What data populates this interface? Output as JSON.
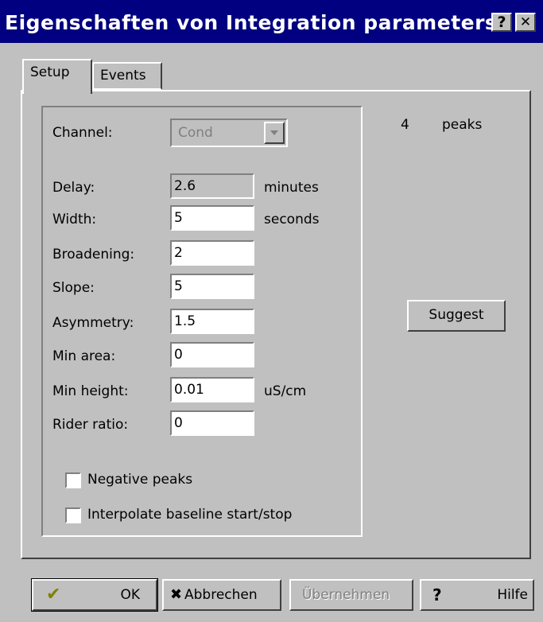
{
  "window": {
    "title": "Eigenschaften von Integration parameters",
    "help_button": "?",
    "close_button": "✕"
  },
  "tabs": [
    {
      "label": "Setup",
      "active": true
    },
    {
      "label": "Events",
      "active": false
    }
  ],
  "channel": {
    "label": "Channel:",
    "value": "Cond"
  },
  "fields": {
    "delay": {
      "label": "Delay:",
      "value": "2.6",
      "unit": "minutes"
    },
    "width": {
      "label": "Width:",
      "value": "5",
      "unit": "seconds"
    },
    "broadening": {
      "label": "Broadening:",
      "value": "2"
    },
    "slope": {
      "label": "Slope:",
      "value": "5"
    },
    "asymmetry": {
      "label": "Asymmetry:",
      "value": "1.5"
    },
    "min_area": {
      "label": "Min area:",
      "value": "0"
    },
    "min_height": {
      "label": "Min height:",
      "value": "0.01",
      "unit": "uS/cm"
    },
    "rider_ratio": {
      "label": "Rider ratio:",
      "value": "0"
    }
  },
  "checkboxes": {
    "negative_peaks": {
      "label": "Negative peaks",
      "checked": false
    },
    "interpolate": {
      "label": "Interpolate baseline start/stop",
      "checked": false
    }
  },
  "peaks": {
    "count": "4",
    "label": "peaks"
  },
  "suggest_button": "Suggest",
  "footer": {
    "ok": "OK",
    "cancel": "Abbrechen",
    "apply": "Übernehmen",
    "help": "Hilfe"
  },
  "colors": {
    "titlebar": "#000080",
    "face": "#c0c0c0"
  }
}
